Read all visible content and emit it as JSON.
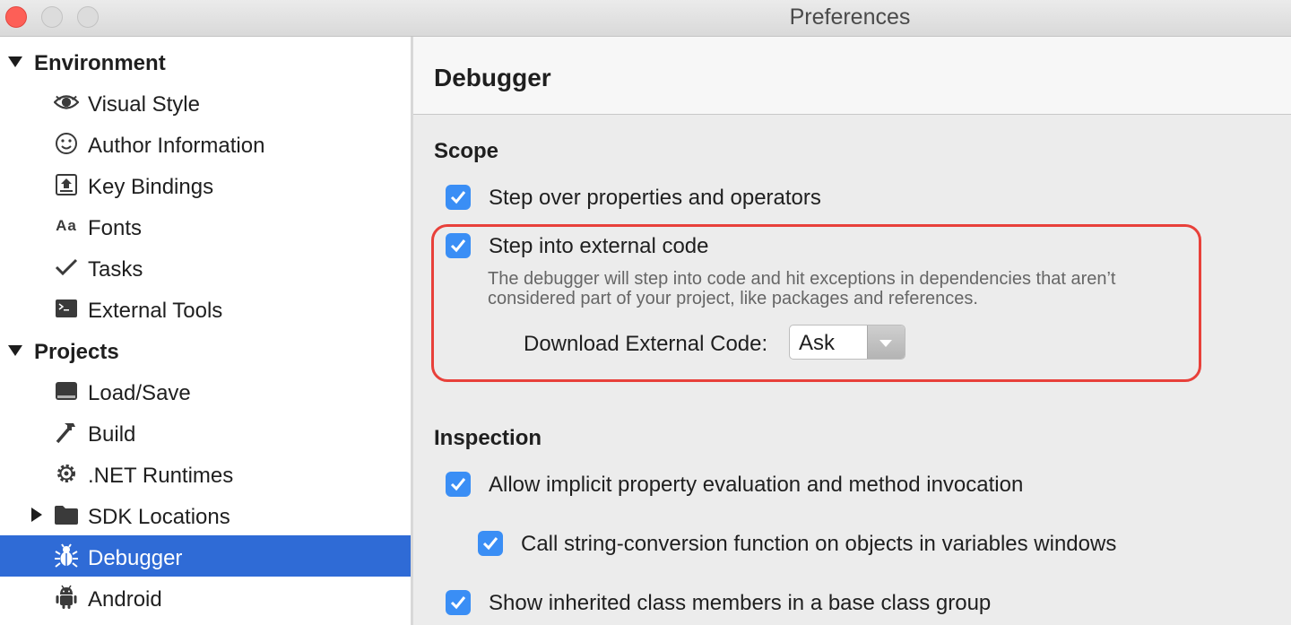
{
  "window": {
    "title": "Preferences"
  },
  "sidebar": {
    "sections": [
      {
        "label": "Environment",
        "expanded": true
      },
      {
        "label": "Projects",
        "expanded": true
      }
    ],
    "environment_items": [
      {
        "label": "Visual Style",
        "icon": "eye-icon"
      },
      {
        "label": "Author Information",
        "icon": "smiley-icon"
      },
      {
        "label": "Key Bindings",
        "icon": "key-upload-icon"
      },
      {
        "label": "Fonts",
        "icon": "font-aa-icon",
        "glyph": "Aa"
      },
      {
        "label": "Tasks",
        "icon": "checkmark-icon"
      },
      {
        "label": "External Tools",
        "icon": "terminal-icon"
      }
    ],
    "project_items": [
      {
        "label": "Load/Save",
        "icon": "drive-icon"
      },
      {
        "label": "Build",
        "icon": "hammer-icon"
      },
      {
        "label": ".NET Runtimes",
        "icon": "gear-icon"
      },
      {
        "label": "SDK Locations",
        "icon": "folder-icon",
        "collapsed": true
      },
      {
        "label": "Debugger",
        "icon": "bug-icon",
        "selected": true
      },
      {
        "label": "Android",
        "icon": "android-icon"
      }
    ]
  },
  "panel": {
    "title": "Debugger",
    "scope": {
      "title": "Scope",
      "step_over": {
        "label": "Step over properties and operators",
        "checked": true
      },
      "step_into": {
        "label": "Step into external code",
        "checked": true
      },
      "description_line1": "The debugger will step into code and hit exceptions in dependencies that aren’t",
      "description_line2": "considered part of your project, like packages and references.",
      "download_label": "Download External Code:",
      "download_value": "Ask"
    },
    "inspection": {
      "title": "Inspection",
      "allow_implicit": {
        "label": "Allow implicit property evaluation and method invocation",
        "checked": true
      },
      "call_string": {
        "label": "Call string-conversion function on objects in variables windows",
        "checked": true
      },
      "show_inherited": {
        "label": "Show inherited class members in a base class group",
        "checked": true
      }
    }
  },
  "colors": {
    "accent": "#2f6bd6",
    "checkbox": "#3a8ef5",
    "highlight": "#e8403a",
    "close_button": "#fd5f57"
  }
}
